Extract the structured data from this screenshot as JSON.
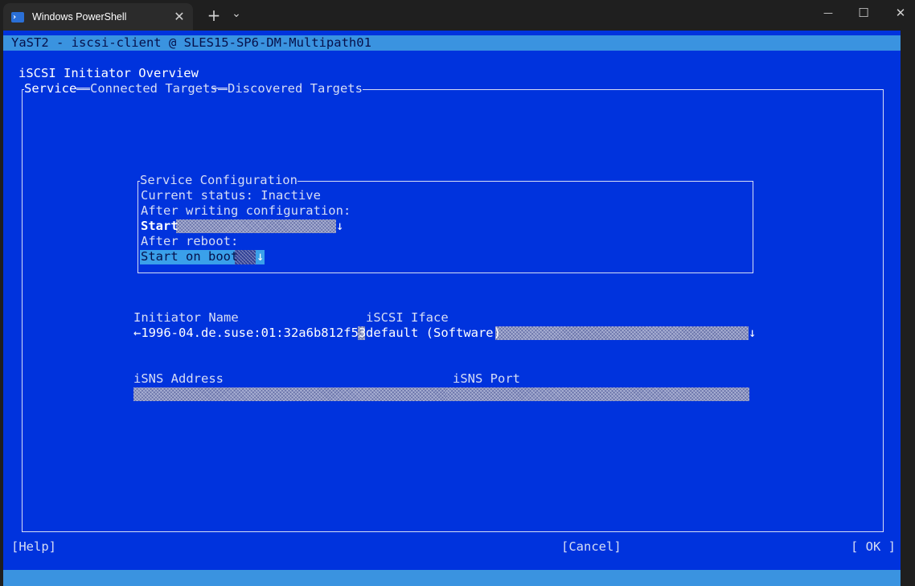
{
  "window": {
    "tab_title": "Windows PowerShell",
    "tab_close": "✕",
    "new_tab": "+",
    "tab_dropdown": "⌄",
    "minimize": "—",
    "maximize": "☐",
    "close": "✕"
  },
  "terminal": {
    "app_title": "YaST2 - iscsi-client @ SLES15-SP6-DM-Multipath01",
    "heading": "iSCSI Initiator Overview",
    "tabs": [
      "Service",
      "Connected Targets",
      "Discovered Targets"
    ],
    "service_config": {
      "title": "Service Configuration",
      "current_status": "Current status: Inactive",
      "after_writing_label": "After writing configuration:",
      "after_writing_value": "Start",
      "after_reboot_label": "After reboot:",
      "after_reboot_value": "Start on boot",
      "dropdown_arrow": "↓"
    },
    "initiator_name_label": "Initiator Name",
    "initiator_name_value": "←1996-04.de.suse:01:32a6b812f53",
    "iscsi_iface_label": "iSCSI Iface",
    "iscsi_iface_value": "default (Software)",
    "isns_address_label": "iSNS Address",
    "isns_port_label": "iSNS Port",
    "buttons": {
      "help": "[Help]",
      "cancel": "[Cancel]",
      "ok": "[ OK ]"
    }
  },
  "colors": {
    "terminal_bg": "#0033dd",
    "status_bar": "#3a93e0",
    "selection": "#3aa0ea"
  }
}
